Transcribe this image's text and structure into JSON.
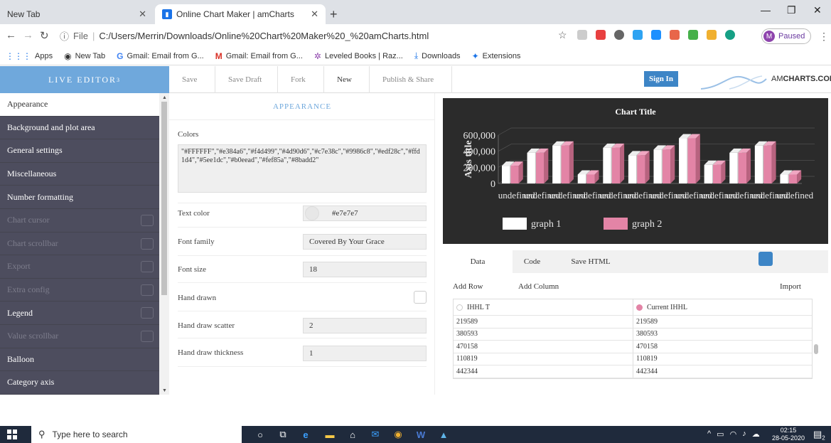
{
  "browser": {
    "tabs": [
      {
        "title": "New Tab",
        "active": false
      },
      {
        "title": "Online Chart Maker | amCharts",
        "active": true
      }
    ],
    "url_prefix": "File",
    "url": "C:/Users/Merrin/Downloads/Online%20Chart%20Maker%20_%20amCharts.html",
    "profile_initial": "M",
    "profile_status": "Paused",
    "bookmarks": [
      {
        "icon": "apps-icon",
        "label": "Apps"
      },
      {
        "icon": "globe-icon",
        "label": "New Tab"
      },
      {
        "icon": "google-icon",
        "label": "Gmail: Email from G..."
      },
      {
        "icon": "gmail-icon",
        "label": "Gmail: Email from G..."
      },
      {
        "icon": "leveled-books-icon",
        "label": "Leveled Books | Raz..."
      },
      {
        "icon": "download-icon",
        "label": "Downloads"
      },
      {
        "icon": "puzzle-icon",
        "label": "Extensions"
      }
    ]
  },
  "header": {
    "live_editor": "LIVE EDITOR",
    "live_editor_version": "3",
    "menu": [
      "Save",
      "Save Draft",
      "Fork",
      "New",
      "Publish & Share"
    ],
    "sign_in": "Sign In",
    "logo_prefix": "AM",
    "logo_suffix": "CHARTS.COM"
  },
  "sidebar": {
    "items": [
      {
        "label": "Appearance",
        "state": "active",
        "checkbox": false
      },
      {
        "label": "Background and plot area",
        "state": "normal",
        "checkbox": false
      },
      {
        "label": "General settings",
        "state": "normal",
        "checkbox": false
      },
      {
        "label": "Miscellaneous",
        "state": "normal",
        "checkbox": false
      },
      {
        "label": "Number formatting",
        "state": "normal",
        "checkbox": false
      },
      {
        "label": "Chart cursor",
        "state": "disabled",
        "checkbox": true
      },
      {
        "label": "Chart scrollbar",
        "state": "disabled",
        "checkbox": true
      },
      {
        "label": "Export",
        "state": "disabled",
        "checkbox": true
      },
      {
        "label": "Extra config",
        "state": "disabled",
        "checkbox": true
      },
      {
        "label": "Legend",
        "state": "normal",
        "checkbox": true
      },
      {
        "label": "Value scrollbar",
        "state": "disabled",
        "checkbox": true
      },
      {
        "label": "Balloon",
        "state": "normal",
        "checkbox": false
      },
      {
        "label": "Category axis",
        "state": "normal",
        "checkbox": false
      }
    ]
  },
  "appearance": {
    "title": "APPEARANCE",
    "colors_label": "Colors",
    "colors_value": "\"#FFFFFF\",\"#e384a6\",\"#f4d499\",\"#4d90d6\",\"#c7e38c\",\"#9986c8\",\"#edf28c\",\"#ffd1d4\",\"#5ee1dc\",\"#b0eead\",\"#fef85a\",\"#8badd2\"",
    "text_color_label": "Text color",
    "text_color_value": "#e7e7e7",
    "font_family_label": "Font family",
    "font_family_value": "Covered By Your Grace",
    "font_size_label": "Font size",
    "font_size_value": "18",
    "hand_drawn_label": "Hand drawn",
    "hand_draw_scatter_label": "Hand draw scatter",
    "hand_draw_scatter_value": "2",
    "hand_draw_thickness_label": "Hand draw thickness",
    "hand_draw_thickness_value": "1"
  },
  "chart_data": {
    "type": "bar",
    "title": "Chart Title",
    "ylabel": "Axis title",
    "ylim": [
      0,
      600000
    ],
    "yticks": [
      "0",
      "200,000",
      "400,000",
      "600,000"
    ],
    "categories": [
      "undefined",
      "undefined",
      "undefined",
      "undefined",
      "undefined",
      "undefined",
      "undefined",
      "undefined",
      "undefined",
      "undefined",
      "undefined",
      "undefined"
    ],
    "series": [
      {
        "name": "graph 1",
        "color": "#FFFFFF",
        "values": [
          219589,
          380593,
          470158,
          110819,
          442344,
          350000,
          420000,
          560000,
          230000,
          380000,
          470000,
          110000
        ]
      },
      {
        "name": "graph 2",
        "color": "#e384a6",
        "values": [
          219589,
          380593,
          470158,
          110819,
          442344,
          350000,
          420000,
          560000,
          230000,
          380000,
          470000,
          110000
        ]
      }
    ],
    "legend": "bottom",
    "background": "#2b2b2b"
  },
  "data_panel": {
    "tabs": [
      "Data",
      "Code",
      "Save HTML"
    ],
    "add_row": "Add Row",
    "add_column": "Add Column",
    "import": "Import",
    "columns": [
      {
        "name": "IHHL T",
        "color": "#FFFFFF"
      },
      {
        "name": "Current IHHL",
        "color": "#e384a6"
      }
    ],
    "rows": [
      [
        "219589",
        "219589"
      ],
      [
        "380593",
        "380593"
      ],
      [
        "470158",
        "470158"
      ],
      [
        "110819",
        "110819"
      ],
      [
        "442344",
        "442344"
      ]
    ]
  },
  "taskbar": {
    "search_placeholder": "Type here to search",
    "time": "02:15",
    "date": "28-05-2020",
    "notifications": "2"
  }
}
